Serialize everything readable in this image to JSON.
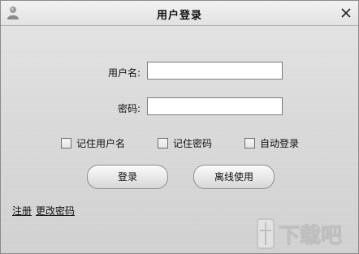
{
  "window": {
    "title": "用户登录",
    "close_icon": "close-icon",
    "app_icon": "user-icon"
  },
  "form": {
    "username_label": "用户名:",
    "username_value": "",
    "password_label": "密码:",
    "password_value": ""
  },
  "options": {
    "remember_username": "记住用户名",
    "remember_password": "记住密码",
    "auto_login": "自动登录"
  },
  "buttons": {
    "login": "登录",
    "offline": "离线使用"
  },
  "links": {
    "register": "注册",
    "change_password": "更改密码"
  },
  "watermark": {
    "text": "下载吧"
  }
}
